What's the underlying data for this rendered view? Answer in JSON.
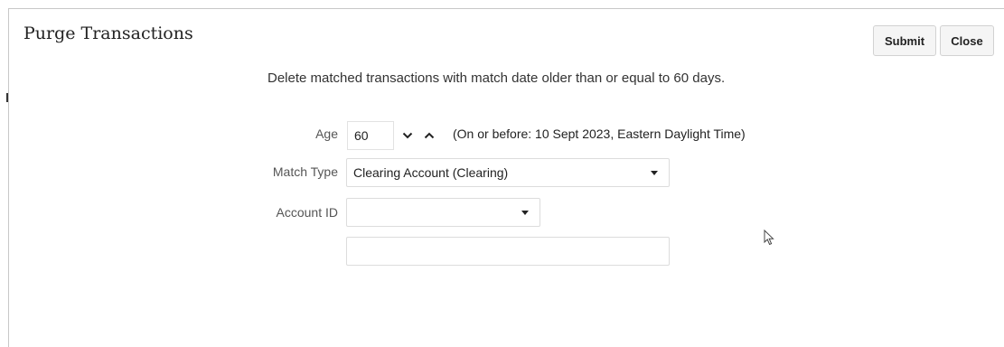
{
  "dialog": {
    "title": "Purge Transactions",
    "buttons": {
      "submit": "Submit",
      "close": "Close"
    },
    "description": "Delete matched transactions with match date older than or equal to 60 days."
  },
  "form": {
    "age": {
      "label": "Age",
      "value": "60",
      "note": "(On or before: 10 Sept 2023, Eastern Daylight Time)"
    },
    "match_type": {
      "label": "Match Type",
      "value": "Clearing Account (Clearing)"
    },
    "account_id": {
      "label": "Account ID",
      "value": ""
    },
    "extra_field": {
      "value": ""
    }
  },
  "icons": [
    "chevron-down-icon",
    "chevron-up-icon",
    "dropdown-caret-icon",
    "mouse-pointer-icon"
  ]
}
